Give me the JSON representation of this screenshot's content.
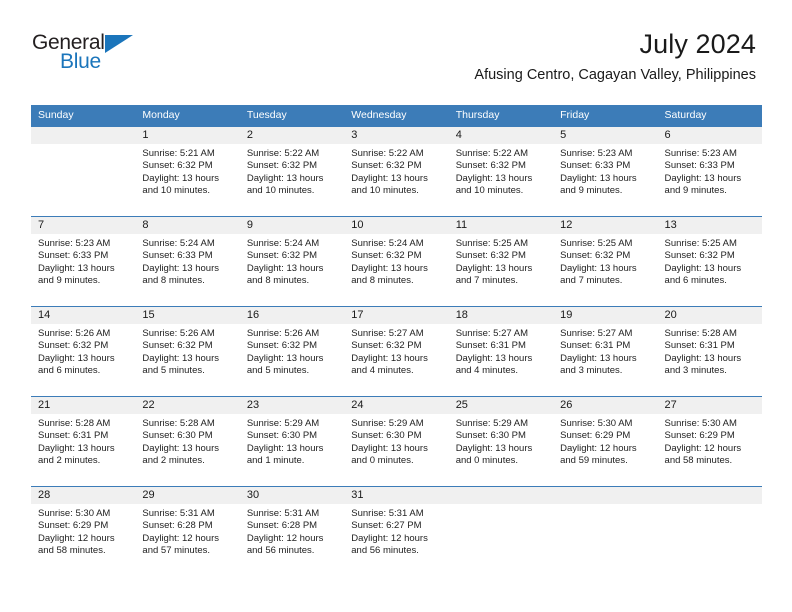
{
  "logo": {
    "line1": "General",
    "line2": "Blue",
    "triangle_icon": "triangle-icon",
    "accent_color": "#1b75bb"
  },
  "header": {
    "title": "July 2024",
    "subtitle": "Afusing Centro, Cagayan Valley, Philippines"
  },
  "theme": {
    "header_blue": "#3c7cb8",
    "daynum_band": "#f0f0f0"
  },
  "calendar": {
    "weekday_headers": [
      "Sunday",
      "Monday",
      "Tuesday",
      "Wednesday",
      "Thursday",
      "Friday",
      "Saturday"
    ],
    "weeks": [
      [
        {
          "day": "",
          "details": ""
        },
        {
          "day": "1",
          "details": "Sunrise: 5:21 AM\nSunset: 6:32 PM\nDaylight: 13 hours and 10 minutes."
        },
        {
          "day": "2",
          "details": "Sunrise: 5:22 AM\nSunset: 6:32 PM\nDaylight: 13 hours and 10 minutes."
        },
        {
          "day": "3",
          "details": "Sunrise: 5:22 AM\nSunset: 6:32 PM\nDaylight: 13 hours and 10 minutes."
        },
        {
          "day": "4",
          "details": "Sunrise: 5:22 AM\nSunset: 6:32 PM\nDaylight: 13 hours and 10 minutes."
        },
        {
          "day": "5",
          "details": "Sunrise: 5:23 AM\nSunset: 6:33 PM\nDaylight: 13 hours and 9 minutes."
        },
        {
          "day": "6",
          "details": "Sunrise: 5:23 AM\nSunset: 6:33 PM\nDaylight: 13 hours and 9 minutes."
        }
      ],
      [
        {
          "day": "7",
          "details": "Sunrise: 5:23 AM\nSunset: 6:33 PM\nDaylight: 13 hours and 9 minutes."
        },
        {
          "day": "8",
          "details": "Sunrise: 5:24 AM\nSunset: 6:33 PM\nDaylight: 13 hours and 8 minutes."
        },
        {
          "day": "9",
          "details": "Sunrise: 5:24 AM\nSunset: 6:32 PM\nDaylight: 13 hours and 8 minutes."
        },
        {
          "day": "10",
          "details": "Sunrise: 5:24 AM\nSunset: 6:32 PM\nDaylight: 13 hours and 8 minutes."
        },
        {
          "day": "11",
          "details": "Sunrise: 5:25 AM\nSunset: 6:32 PM\nDaylight: 13 hours and 7 minutes."
        },
        {
          "day": "12",
          "details": "Sunrise: 5:25 AM\nSunset: 6:32 PM\nDaylight: 13 hours and 7 minutes."
        },
        {
          "day": "13",
          "details": "Sunrise: 5:25 AM\nSunset: 6:32 PM\nDaylight: 13 hours and 6 minutes."
        }
      ],
      [
        {
          "day": "14",
          "details": "Sunrise: 5:26 AM\nSunset: 6:32 PM\nDaylight: 13 hours and 6 minutes."
        },
        {
          "day": "15",
          "details": "Sunrise: 5:26 AM\nSunset: 6:32 PM\nDaylight: 13 hours and 5 minutes."
        },
        {
          "day": "16",
          "details": "Sunrise: 5:26 AM\nSunset: 6:32 PM\nDaylight: 13 hours and 5 minutes."
        },
        {
          "day": "17",
          "details": "Sunrise: 5:27 AM\nSunset: 6:32 PM\nDaylight: 13 hours and 4 minutes."
        },
        {
          "day": "18",
          "details": "Sunrise: 5:27 AM\nSunset: 6:31 PM\nDaylight: 13 hours and 4 minutes."
        },
        {
          "day": "19",
          "details": "Sunrise: 5:27 AM\nSunset: 6:31 PM\nDaylight: 13 hours and 3 minutes."
        },
        {
          "day": "20",
          "details": "Sunrise: 5:28 AM\nSunset: 6:31 PM\nDaylight: 13 hours and 3 minutes."
        }
      ],
      [
        {
          "day": "21",
          "details": "Sunrise: 5:28 AM\nSunset: 6:31 PM\nDaylight: 13 hours and 2 minutes."
        },
        {
          "day": "22",
          "details": "Sunrise: 5:28 AM\nSunset: 6:30 PM\nDaylight: 13 hours and 2 minutes."
        },
        {
          "day": "23",
          "details": "Sunrise: 5:29 AM\nSunset: 6:30 PM\nDaylight: 13 hours and 1 minute."
        },
        {
          "day": "24",
          "details": "Sunrise: 5:29 AM\nSunset: 6:30 PM\nDaylight: 13 hours and 0 minutes."
        },
        {
          "day": "25",
          "details": "Sunrise: 5:29 AM\nSunset: 6:30 PM\nDaylight: 13 hours and 0 minutes."
        },
        {
          "day": "26",
          "details": "Sunrise: 5:30 AM\nSunset: 6:29 PM\nDaylight: 12 hours and 59 minutes."
        },
        {
          "day": "27",
          "details": "Sunrise: 5:30 AM\nSunset: 6:29 PM\nDaylight: 12 hours and 58 minutes."
        }
      ],
      [
        {
          "day": "28",
          "details": "Sunrise: 5:30 AM\nSunset: 6:29 PM\nDaylight: 12 hours and 58 minutes."
        },
        {
          "day": "29",
          "details": "Sunrise: 5:31 AM\nSunset: 6:28 PM\nDaylight: 12 hours and 57 minutes."
        },
        {
          "day": "30",
          "details": "Sunrise: 5:31 AM\nSunset: 6:28 PM\nDaylight: 12 hours and 56 minutes."
        },
        {
          "day": "31",
          "details": "Sunrise: 5:31 AM\nSunset: 6:27 PM\nDaylight: 12 hours and 56 minutes."
        },
        {
          "day": "",
          "details": ""
        },
        {
          "day": "",
          "details": ""
        },
        {
          "day": "",
          "details": ""
        }
      ]
    ]
  }
}
